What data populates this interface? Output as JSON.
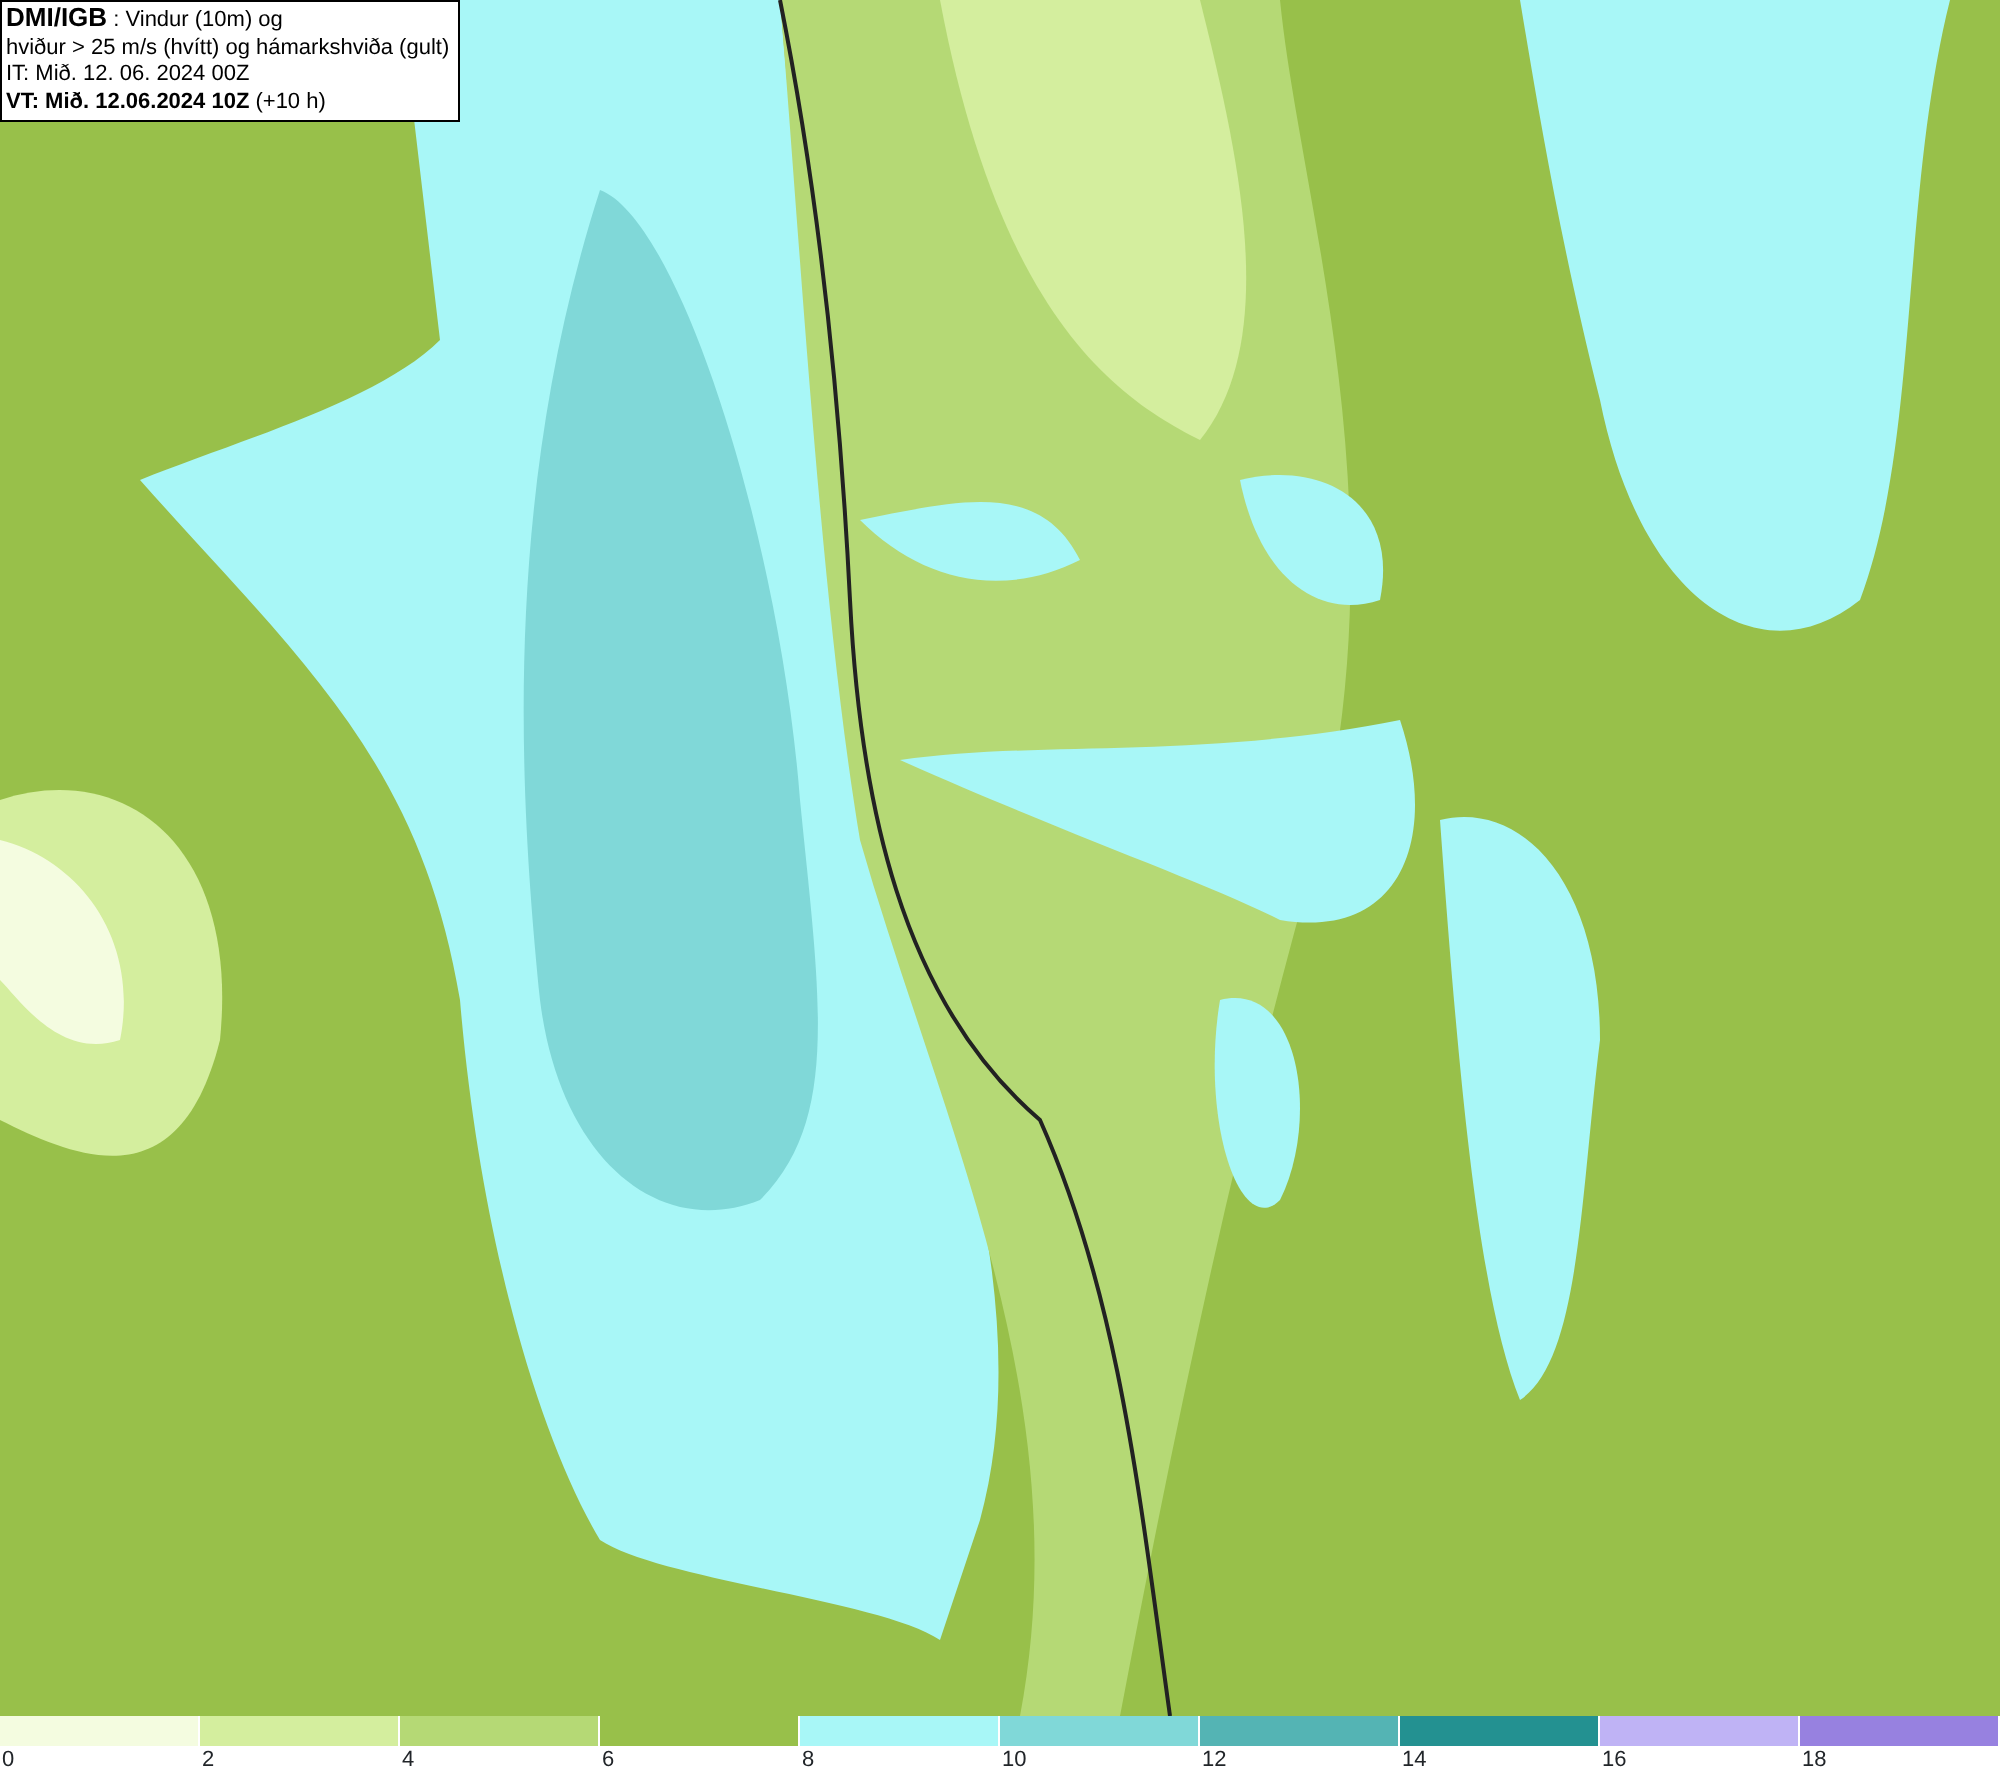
{
  "header": {
    "lines": [
      "**DMI/IGB** : Vindur (10m) og",
      "hviður > 25 m/s (hvítt) og hámarkshviða (gult)",
      "IT: Mið. 12. 06. 2024 00Z",
      "**VT: Mið. 12.06.2024 10Z** (+10 h)"
    ]
  },
  "legend": {
    "bins": [
      {
        "color": "#f4fce0",
        "label": "0"
      },
      {
        "color": "#d4ee9e",
        "label": "2"
      },
      {
        "color": "#b5d975",
        "label": "4"
      },
      {
        "color": "#98c04a",
        "label": "6"
      },
      {
        "color": "#a8f7f7",
        "label": "8"
      },
      {
        "color": "#80d8d8",
        "label": "10"
      },
      {
        "color": "#54b4b4",
        "label": "12"
      },
      {
        "color": "#239191",
        "label": "14"
      },
      {
        "color": "#bfb3f5",
        "label": "16"
      },
      {
        "color": "#9781e0",
        "label": "18"
      }
    ]
  }
}
